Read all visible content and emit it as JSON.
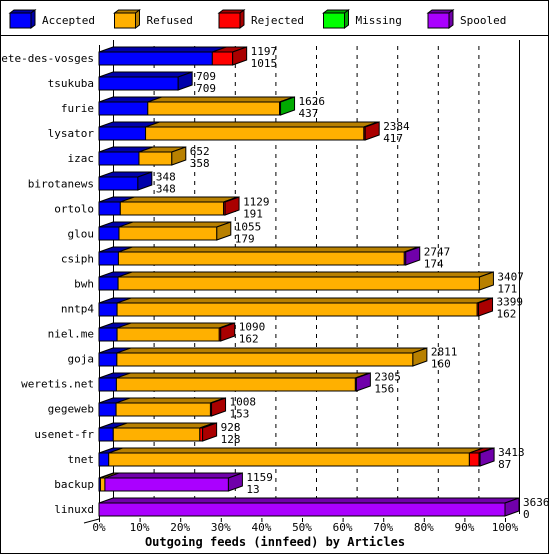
{
  "chart_data": {
    "type": "bar",
    "orientation": "horizontal",
    "stacked": true,
    "three_d": true,
    "title": "Outgoing feeds (innfeed) by Articles",
    "xlabel": "",
    "ylabel": "",
    "xlim": [
      0,
      100
    ],
    "x_unit": "%",
    "x_ticks": [
      "0%",
      "10%",
      "20%",
      "30%",
      "40%",
      "50%",
      "60%",
      "70%",
      "80%",
      "90%",
      "100%"
    ],
    "grid": true,
    "legend_position": "top",
    "legend": [
      {
        "name": "Accepted",
        "color": "#0000ff",
        "shade": "#0000aa"
      },
      {
        "name": "Refused",
        "color": "#ffb000",
        "shade": "#b88000"
      },
      {
        "name": "Rejected",
        "color": "#ff0000",
        "shade": "#aa0000"
      },
      {
        "name": "Missing",
        "color": "#00ff00",
        "shade": "#00aa00"
      },
      {
        "name": "Spooled",
        "color": "#aa00ff",
        "shade": "#7000aa"
      }
    ],
    "max_total": 3636,
    "categories": [
      "bete-des-vosges",
      "tsukuba",
      "furie",
      "lysator",
      "izac",
      "birotanews",
      "ortolo",
      "glou",
      "csiph",
      "bwh",
      "nntp4",
      "niel.me",
      "goja",
      "weretis.net",
      "gegeweb",
      "usenet-fr",
      "tnet",
      "backup",
      "linuxd"
    ],
    "totals": [
      1197,
      709,
      1626,
      2384,
      652,
      348,
      1129,
      1055,
      2747,
      3407,
      3399,
      1090,
      2811,
      2305,
      1008,
      928,
      3413,
      1159,
      3636
    ],
    "series": [
      {
        "name": "Accepted",
        "values": [
          1015,
          709,
          437,
          417,
          358,
          348,
          191,
          179,
          174,
          171,
          162,
          162,
          160,
          156,
          153,
          128,
          87,
          13,
          0
        ]
      },
      {
        "name": "Refused",
        "values": [
          0,
          0,
          1180,
          1955,
          294,
          0,
          925,
          876,
          2560,
          3236,
          3225,
          915,
          2651,
          2140,
          845,
          775,
          3230,
          40,
          0
        ]
      },
      {
        "name": "Rejected",
        "values": [
          182,
          0,
          0,
          12,
          0,
          0,
          13,
          0,
          0,
          0,
          12,
          13,
          0,
          0,
          10,
          25,
          86,
          0,
          0
        ]
      },
      {
        "name": "Missing",
        "values": [
          0,
          0,
          9,
          0,
          0,
          0,
          0,
          0,
          0,
          0,
          0,
          0,
          0,
          0,
          0,
          0,
          0,
          0,
          0
        ]
      },
      {
        "name": "Spooled",
        "values": [
          0,
          0,
          0,
          0,
          0,
          0,
          0,
          0,
          13,
          0,
          0,
          0,
          0,
          9,
          0,
          0,
          10,
          1106,
          3636
        ]
      }
    ]
  }
}
